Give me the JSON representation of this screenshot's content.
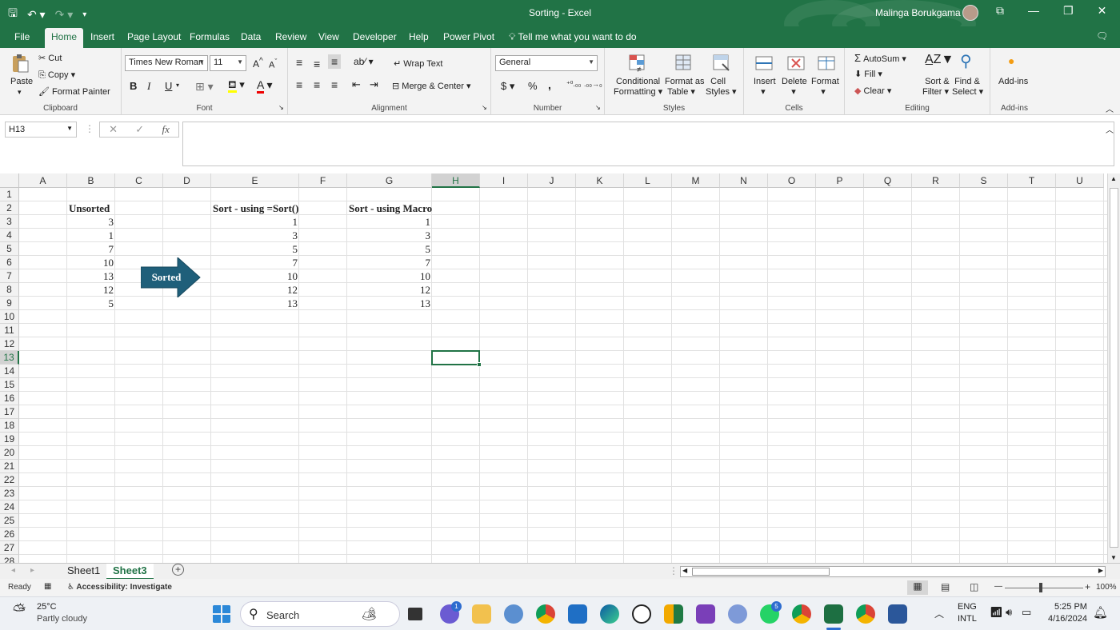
{
  "titlebar": {
    "title": "Sorting  -  Excel",
    "user": "Malinga Borukgama"
  },
  "menu": {
    "tabs": [
      "File",
      "Home",
      "Insert",
      "Page Layout",
      "Formulas",
      "Data",
      "Review",
      "View",
      "Developer",
      "Help",
      "Power Pivot"
    ],
    "active_tab": "Home",
    "tell_me": "Tell me what you want to do"
  },
  "ribbon": {
    "clipboard": {
      "label": "Clipboard",
      "paste": "Paste",
      "cut": "Cut",
      "copy": "Copy",
      "format_painter": "Format Painter"
    },
    "font": {
      "label": "Font",
      "font_name": "Times New Roman",
      "font_size": "11",
      "bold": "B",
      "italic": "I",
      "underline": "U"
    },
    "alignment": {
      "label": "Alignment",
      "wrap_text": "Wrap Text",
      "merge_center": "Merge & Center"
    },
    "number": {
      "label": "Number",
      "format": "General",
      "currency": "$",
      "percent": "%",
      "comma": ","
    },
    "styles": {
      "label": "Styles",
      "conditional_1": "Conditional",
      "conditional_2": "Formatting",
      "format_table_1": "Format as",
      "format_table_2": "Table",
      "cell_styles_1": "Cell",
      "cell_styles_2": "Styles"
    },
    "cells": {
      "label": "Cells",
      "insert": "Insert",
      "delete": "Delete",
      "format": "Format"
    },
    "editing": {
      "label": "Editing",
      "autosum": "AutoSum",
      "fill": "Fill",
      "clear": "Clear",
      "sort_filter_1": "Sort &",
      "sort_filter_2": "Filter",
      "find_select_1": "Find &",
      "find_select_2": "Select"
    },
    "addins": {
      "label": "Add-ins",
      "addins": "Add-ins"
    }
  },
  "formula_bar": {
    "name_box": "H13",
    "formula": ""
  },
  "grid": {
    "columns": [
      "A",
      "B",
      "C",
      "D",
      "E",
      "F",
      "G",
      "H",
      "I",
      "J",
      "K",
      "L",
      "M",
      "N",
      "O",
      "P",
      "Q",
      "R",
      "S",
      "T",
      "U"
    ],
    "selected_column": "H",
    "rows": [
      "1",
      "2",
      "3",
      "4",
      "5",
      "6",
      "7",
      "8",
      "9",
      "10",
      "11",
      "12",
      "13",
      "14",
      "15",
      "16",
      "17",
      "18",
      "19",
      "20",
      "21",
      "22",
      "23",
      "24",
      "25",
      "26",
      "27",
      "28"
    ],
    "selected_row": "13",
    "headers": {
      "b2": "Unsorted",
      "e2": "Sort - using =Sort()",
      "g2": "Sort - using Macro"
    },
    "unsorted": [
      "3",
      "1",
      "7",
      "10",
      "13",
      "12",
      "5"
    ],
    "sort_formula": [
      "1",
      "3",
      "5",
      "7",
      "10",
      "12",
      "13"
    ],
    "sort_macro": [
      "1",
      "3",
      "5",
      "7",
      "10",
      "12",
      "13"
    ],
    "arrow_label": "Sorted"
  },
  "sheets": {
    "tabs": [
      "Sheet1",
      "Sheet3"
    ],
    "active": "Sheet3"
  },
  "status": {
    "ready": "Ready",
    "accessibility": "Accessibility: Investigate",
    "zoom": "100%"
  },
  "taskbar": {
    "weather_temp": "25°C",
    "weather_desc": "Partly cloudy",
    "search": "Search",
    "lang_1": "ENG",
    "lang_2": "INTL",
    "time": "5:25 PM",
    "date": "4/16/2024",
    "badge_chat": "1",
    "badge_whatsapp": "5"
  },
  "colors": {
    "excel_green": "#217346",
    "arrow": "#1f5f7a"
  }
}
